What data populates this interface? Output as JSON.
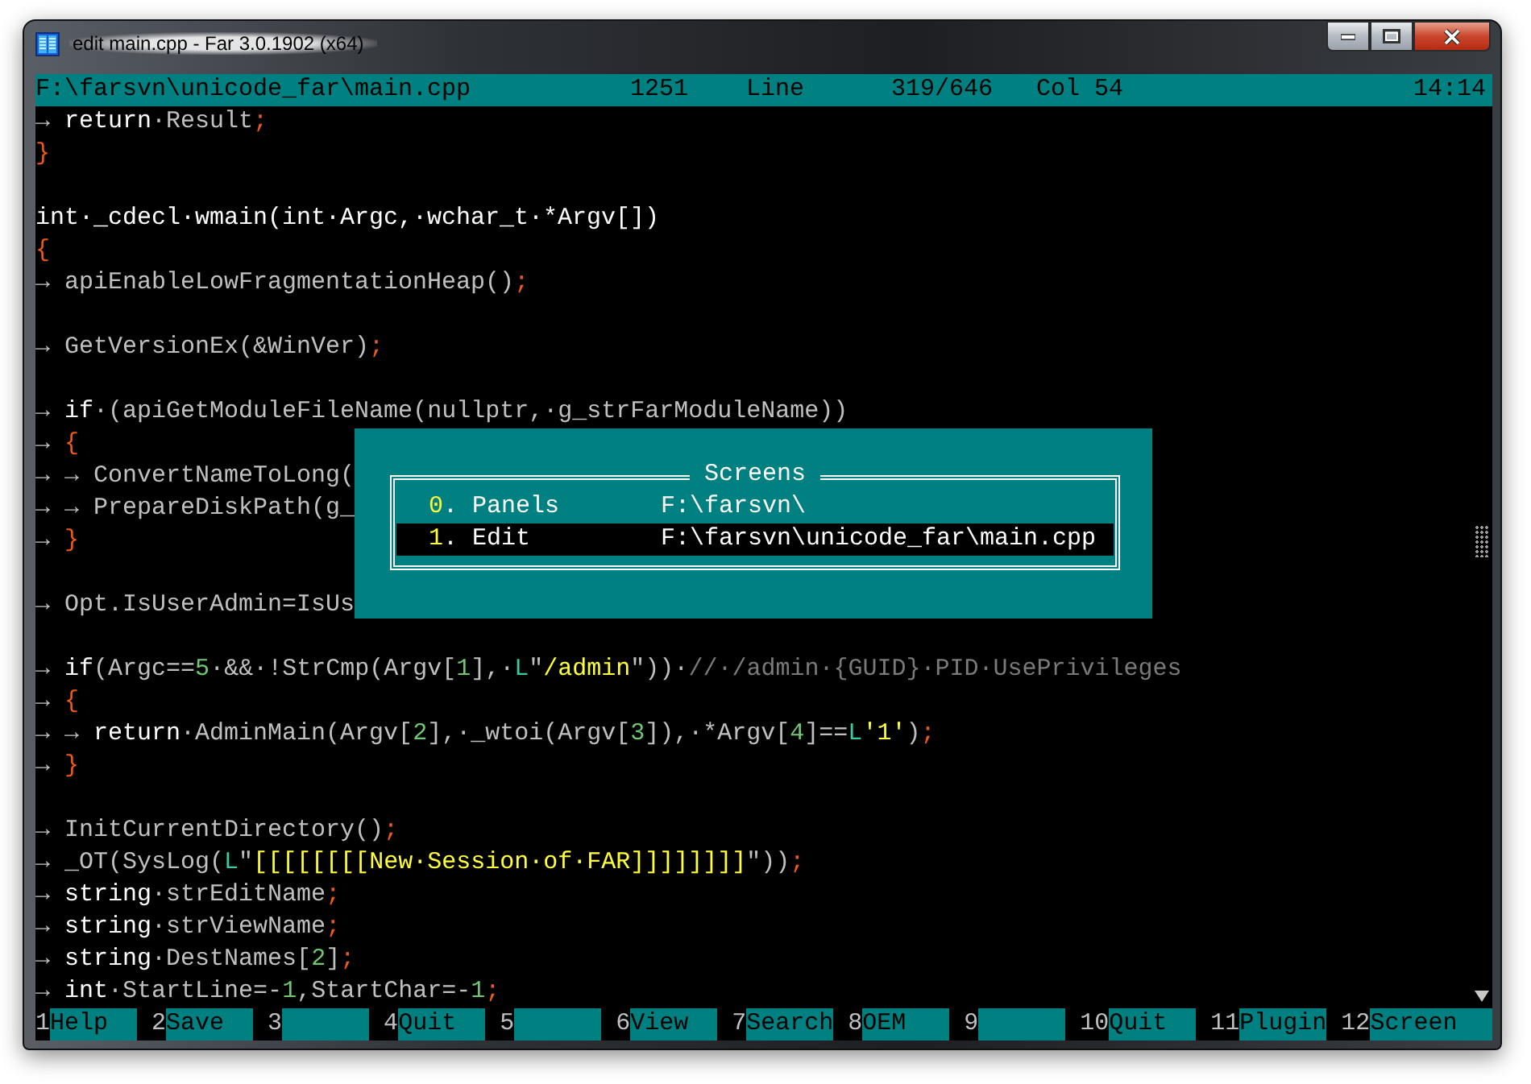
{
  "window": {
    "title": "edit main.cpp - Far 3.0.1902 (x64)"
  },
  "status_bar": {
    "file": "F:\\farsvn\\unicode_far\\main.cpp",
    "codepage": "1251",
    "line_label": "Line",
    "line": "319/646",
    "column": "Col 54",
    "time": "14:14"
  },
  "lines": [
    {
      "kind": "code",
      "tokens": [
        {
          "kind": "id",
          "text": "→ "
        },
        {
          "kind": "kw",
          "text": "return"
        },
        {
          "kind": "id",
          "text": "·Result"
        },
        {
          "kind": "op",
          "text": ";"
        }
      ]
    },
    {
      "kind": "code",
      "tokens": [
        {
          "kind": "op",
          "text": "}"
        }
      ]
    },
    {
      "kind": "blank"
    },
    {
      "kind": "code",
      "tokens": [
        {
          "kind": "kw",
          "text": "int·_cdecl·wmain(int·Argc,·wchar_t·*Argv[])"
        }
      ]
    },
    {
      "kind": "code",
      "tokens": [
        {
          "kind": "op",
          "text": "{"
        }
      ]
    },
    {
      "kind": "code",
      "tokens": [
        {
          "kind": "id",
          "text": "→ apiEnableLowFragmentationHeap()"
        },
        {
          "kind": "op",
          "text": ";"
        }
      ]
    },
    {
      "kind": "blank"
    },
    {
      "kind": "code",
      "tokens": [
        {
          "kind": "id",
          "text": "→ GetVersionEx(&WinVer)"
        },
        {
          "kind": "op",
          "text": ";"
        }
      ]
    },
    {
      "kind": "blank"
    },
    {
      "kind": "code",
      "tokens": [
        {
          "kind": "id",
          "text": "→ "
        },
        {
          "kind": "kw",
          "text": "if"
        },
        {
          "kind": "id",
          "text": "·(apiGetModuleFileName(nullptr,·g_strFarModuleName))"
        }
      ]
    },
    {
      "kind": "code",
      "tokens": [
        {
          "kind": "id",
          "text": "→ "
        },
        {
          "kind": "op",
          "text": "{"
        }
      ]
    },
    {
      "kind": "code",
      "tokens": [
        {
          "kind": "id",
          "text": "→ → ConvertNameToLong("
        }
      ]
    },
    {
      "kind": "code",
      "tokens": [
        {
          "kind": "id",
          "text": "→ → PrepareDiskPath(g_"
        }
      ]
    },
    {
      "kind": "code",
      "tokens": [
        {
          "kind": "id",
          "text": "→ "
        },
        {
          "kind": "op",
          "text": "}"
        }
      ]
    },
    {
      "kind": "blank"
    },
    {
      "kind": "code",
      "tokens": [
        {
          "kind": "id",
          "text": "→ Opt.IsUserAdmin=IsUs"
        }
      ]
    },
    {
      "kind": "blank"
    },
    {
      "kind": "code",
      "tokens": [
        {
          "kind": "id",
          "text": "→ "
        },
        {
          "kind": "kw",
          "text": "if"
        },
        {
          "kind": "id",
          "text": "(Argc=="
        },
        {
          "kind": "num",
          "text": "5"
        },
        {
          "kind": "id",
          "text": "·&&·!StrCmp(Argv["
        },
        {
          "kind": "num",
          "text": "1"
        },
        {
          "kind": "id",
          "text": "],·"
        },
        {
          "kind": "pre",
          "text": "L"
        },
        {
          "kind": "id",
          "text": "\""
        },
        {
          "kind": "str",
          "text": "/admin"
        },
        {
          "kind": "id",
          "text": "\"))·"
        },
        {
          "kind": "cmt",
          "text": "//·/admin·{GUID}·PID·UsePrivileges"
        }
      ]
    },
    {
      "kind": "code",
      "tokens": [
        {
          "kind": "id",
          "text": "→ "
        },
        {
          "kind": "op",
          "text": "{"
        }
      ]
    },
    {
      "kind": "code",
      "tokens": [
        {
          "kind": "id",
          "text": "→ → "
        },
        {
          "kind": "kw",
          "text": "return"
        },
        {
          "kind": "id",
          "text": "·AdminMain(Argv["
        },
        {
          "kind": "num",
          "text": "2"
        },
        {
          "kind": "id",
          "text": "],·_wtoi(Argv["
        },
        {
          "kind": "num",
          "text": "3"
        },
        {
          "kind": "id",
          "text": "]),·*Argv["
        },
        {
          "kind": "num",
          "text": "4"
        },
        {
          "kind": "id",
          "text": "]=="
        },
        {
          "kind": "pre",
          "text": "L"
        },
        {
          "kind": "str",
          "text": "'1'"
        },
        {
          "kind": "id",
          "text": ")"
        },
        {
          "kind": "op",
          "text": ";"
        }
      ]
    },
    {
      "kind": "code",
      "tokens": [
        {
          "kind": "id",
          "text": "→ "
        },
        {
          "kind": "op",
          "text": "}"
        }
      ]
    },
    {
      "kind": "blank"
    },
    {
      "kind": "code",
      "tokens": [
        {
          "kind": "id",
          "text": "→ InitCurrentDirectory()"
        },
        {
          "kind": "op",
          "text": ";"
        }
      ]
    },
    {
      "kind": "code",
      "tokens": [
        {
          "kind": "id",
          "text": "→ _OT(SysLog("
        },
        {
          "kind": "pre",
          "text": "L"
        },
        {
          "kind": "id",
          "text": "\""
        },
        {
          "kind": "str",
          "text": "[[[[[[[[New·Session·of·FAR]]]]]]]]"
        },
        {
          "kind": "id",
          "text": "\"))"
        },
        {
          "kind": "op",
          "text": ";"
        }
      ]
    },
    {
      "kind": "code",
      "tokens": [
        {
          "kind": "id",
          "text": "→ "
        },
        {
          "kind": "kw",
          "text": "string"
        },
        {
          "kind": "id",
          "text": "·strEditName"
        },
        {
          "kind": "op",
          "text": ";"
        }
      ]
    },
    {
      "kind": "code",
      "tokens": [
        {
          "kind": "id",
          "text": "→ "
        },
        {
          "kind": "kw",
          "text": "string"
        },
        {
          "kind": "id",
          "text": "·strViewName"
        },
        {
          "kind": "op",
          "text": ";"
        }
      ]
    },
    {
      "kind": "code",
      "tokens": [
        {
          "kind": "id",
          "text": "→ "
        },
        {
          "kind": "kw",
          "text": "string"
        },
        {
          "kind": "id",
          "text": "·DestNames["
        },
        {
          "kind": "num",
          "text": "2"
        },
        {
          "kind": "id",
          "text": "]"
        },
        {
          "kind": "op",
          "text": ";"
        }
      ]
    },
    {
      "kind": "code",
      "tokens": [
        {
          "kind": "id",
          "text": "→ "
        },
        {
          "kind": "kw",
          "text": "int"
        },
        {
          "kind": "id",
          "text": "·StartLine=-"
        },
        {
          "kind": "num",
          "text": "1"
        },
        {
          "kind": "id",
          "text": ",StartChar=-"
        },
        {
          "kind": "num",
          "text": "1"
        },
        {
          "kind": "op",
          "text": ";"
        }
      ]
    }
  ],
  "screens_dialog": {
    "title": "Screens",
    "items": [
      {
        "hotkey": "0",
        "label": ". Panels",
        "path": "F:\\farsvn\\",
        "selected": false
      },
      {
        "hotkey": "1",
        "label": ". Edit",
        "path": "F:\\farsvn\\unicode_far\\main.cpp",
        "selected": true
      }
    ]
  },
  "keybar": [
    {
      "number": "1",
      "label": "Help"
    },
    {
      "number": "2",
      "label": "Save"
    },
    {
      "number": "3"
    },
    {
      "number": "4",
      "label": "Quit"
    },
    {
      "number": "5"
    },
    {
      "number": "6",
      "label": "View"
    },
    {
      "number": "7",
      "label": "Search"
    },
    {
      "number": "8",
      "label": "OEM"
    },
    {
      "number": "9"
    },
    {
      "number": "10",
      "label": "Quit"
    },
    {
      "number": "11",
      "label": "Plugin"
    },
    {
      "number": "12",
      "label": "Screen"
    }
  ]
}
